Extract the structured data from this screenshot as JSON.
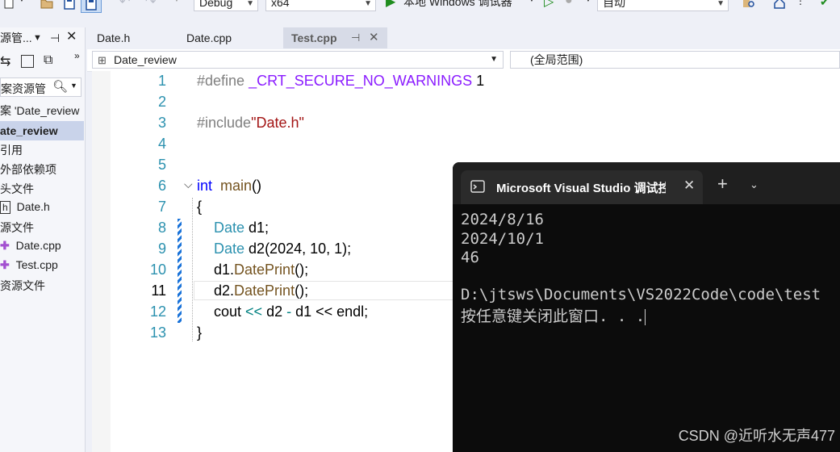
{
  "toolbar": {
    "config": "Debug",
    "platform": "x64",
    "run_label": "本地 Windows 调试器",
    "run_mode": "自动"
  },
  "solution_explorer": {
    "title": "源管...",
    "search_placeholder": "案资源管",
    "items": [
      {
        "label": "案 'Date_review"
      },
      {
        "label": "ate_review"
      },
      {
        "label": "引用"
      },
      {
        "label": "外部依赖项"
      },
      {
        "label": "头文件"
      },
      {
        "label": "Date.h"
      },
      {
        "label": "源文件"
      },
      {
        "label": "Date.cpp"
      },
      {
        "label": "Test.cpp"
      },
      {
        "label": "资源文件"
      }
    ]
  },
  "tabs": [
    {
      "label": "Date.h"
    },
    {
      "label": "Date.cpp"
    },
    {
      "label": "Test.cpp"
    }
  ],
  "navbar": {
    "project": "Date_review",
    "scope": "(全局范围)"
  },
  "editor": {
    "line_numbers": [
      "1",
      "2",
      "3",
      "4",
      "5",
      "6",
      "7",
      "8",
      "9",
      "10",
      "11",
      "12",
      "13"
    ],
    "l1_pre": "#define ",
    "l1_macro": "_CRT_SECURE_NO_WARNINGS",
    "l1_val": " 1",
    "l3_pre": "#include",
    "l3_str": "\"Date.h\"",
    "l6_kw": "int",
    "l6_fn": "main",
    "l6_rest": "()",
    "l7": "{",
    "l8_ty": "Date",
    "l8_rest": " d1;",
    "l9_ty": "Date",
    "l9_fn": " d2",
    "l9_rest": "(2024, 10, 1);",
    "l10_obj": "d1.",
    "l10_fn": "DatePrint",
    "l10_rest": "();",
    "l11_obj": "d2.",
    "l11_fn": "DatePrint",
    "l11_rest": "();",
    "l12_a": "cout ",
    "l12_op1": "<<",
    "l12_b": " d2 ",
    "l12_op2": "-",
    "l12_c": " d1 << endl;",
    "l13": "}"
  },
  "console": {
    "title": "Microsoft Visual Studio 调试控",
    "lines": [
      "2024/8/16",
      "2024/10/1",
      "46",
      "",
      "D:\\jtsws\\Documents\\VS2022Code\\code\\test",
      "按任意键关闭此窗口. . ."
    ]
  },
  "watermark": "CSDN @近听水无声477"
}
